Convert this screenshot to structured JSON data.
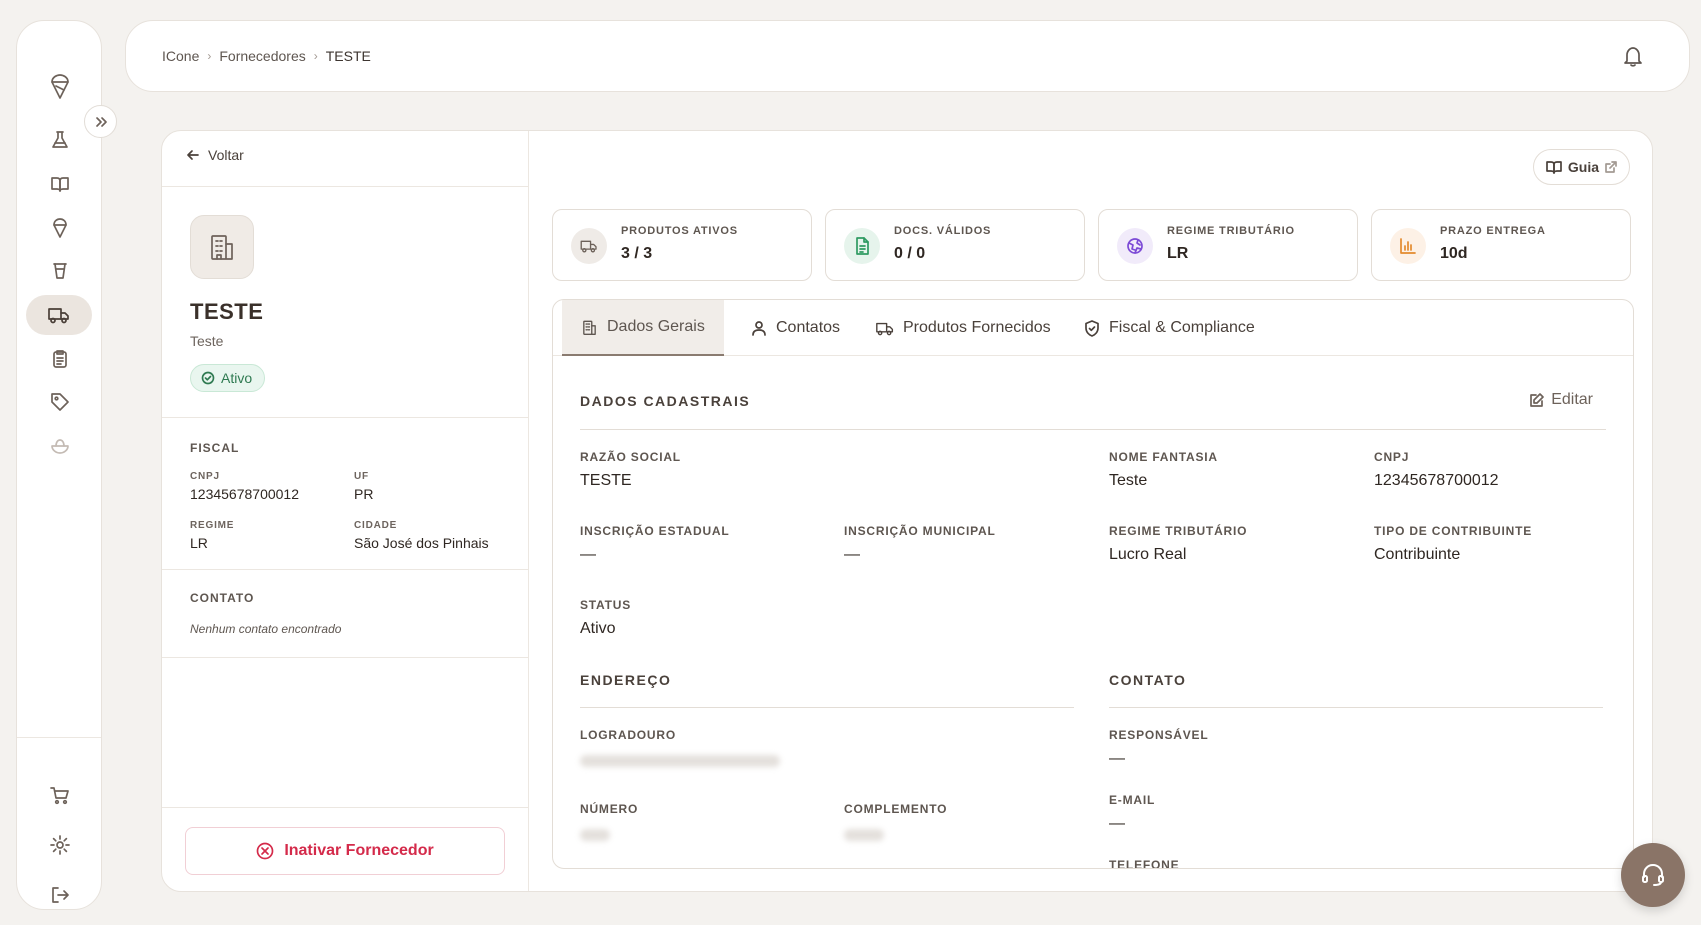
{
  "breadcrumb": {
    "root": "ICone",
    "section": "Fornecedores",
    "current": "TESTE"
  },
  "sidebar": {
    "icons": [
      "logo-icon",
      "flask-icon",
      "book-icon",
      "ice-cream-icon",
      "cup-icon",
      "truck-icon",
      "clipboard-icon",
      "tag-icon",
      "bowl-icon",
      "cart-icon",
      "gear-icon",
      "logout-icon"
    ],
    "active": "truck-icon"
  },
  "left": {
    "back_label": "Voltar",
    "name": "TESTE",
    "subtitle": "Teste",
    "status": "Ativo",
    "fiscal": {
      "title": "FISCAL",
      "cnpj_label": "CNPJ",
      "cnpj": "12345678700012",
      "uf_label": "UF",
      "uf": "PR",
      "regime_label": "REGIME",
      "regime": "LR",
      "cidade_label": "CIDADE",
      "cidade": "São José dos Pinhais"
    },
    "contato": {
      "title": "CONTATO",
      "empty": "Nenhum contato encontrado"
    },
    "inactivate_label": "Inativar Fornecedor"
  },
  "guia_label": "Guia",
  "stats": [
    {
      "label": "PRODUTOS ATIVOS",
      "value": "3 / 3",
      "icon": "truck-icon"
    },
    {
      "label": "DOCS. VÁLIDOS",
      "value": "0 / 0",
      "icon": "file-icon"
    },
    {
      "label": "REGIME TRIBUTÁRIO",
      "value": "LR",
      "icon": "globe-icon"
    },
    {
      "label": "PRAZO ENTREGA",
      "value": "10d",
      "icon": "bar-chart-icon"
    }
  ],
  "tabs": [
    {
      "label": "Dados Gerais",
      "active": true
    },
    {
      "label": "Contatos",
      "active": false
    },
    {
      "label": "Produtos Fornecidos",
      "active": false
    },
    {
      "label": "Fiscal & Compliance",
      "active": false
    }
  ],
  "dados": {
    "title": "DADOS CADASTRAIS",
    "edit_label": "Editar",
    "razao_label": "RAZÃO SOCIAL",
    "razao": "TESTE",
    "fantasia_label": "NOME FANTASIA",
    "fantasia": "Teste",
    "cnpj_label": "CNPJ",
    "cnpj": "12345678700012",
    "ie_label": "INSCRIÇÃO ESTADUAL",
    "ie": "—",
    "im_label": "INSCRIÇÃO MUNICIPAL",
    "im": "—",
    "regime_label": "REGIME TRIBUTÁRIO",
    "regime": "Lucro Real",
    "contrib_label": "TIPO DE CONTRIBUINTE",
    "contrib": "Contribuinte",
    "status_label": "STATUS",
    "status": "Ativo"
  },
  "endereco": {
    "title": "ENDEREÇO",
    "logradouro_label": "LOGRADOURO",
    "numero_label": "NÚMERO",
    "complemento_label": "COMPLEMENTO"
  },
  "contato": {
    "title": "CONTATO",
    "responsavel_label": "RESPONSÁVEL",
    "responsavel": "—",
    "email_label": "E-MAIL",
    "email": "—",
    "telefone_label": "TELEFONE"
  }
}
